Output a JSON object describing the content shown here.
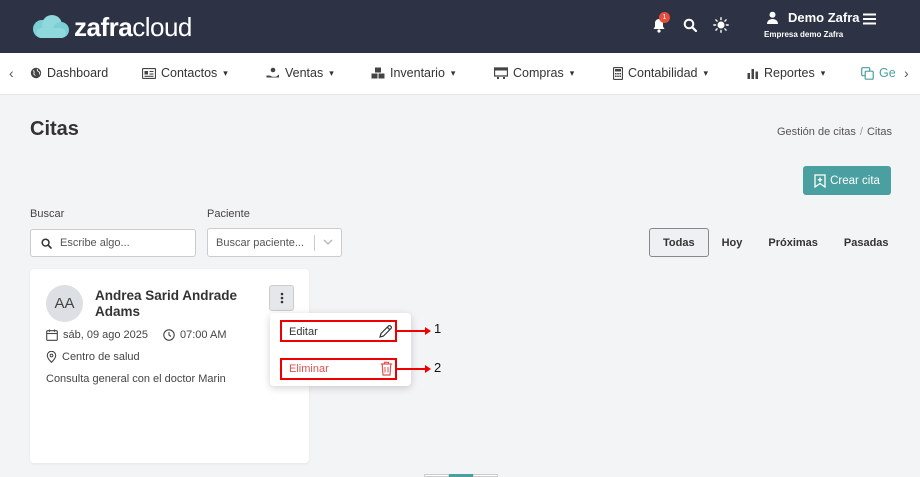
{
  "brand": {
    "logo_bold": "zafra",
    "logo_light": "cloud",
    "accent": "#4a9fa0",
    "header_bg": "#2d3345"
  },
  "header": {
    "notification_count": "1",
    "user_name": "Demo Zafra",
    "company": "Empresa demo Zafra",
    "icons": [
      "bell-icon",
      "search-icon",
      "sun-icon",
      "user-icon",
      "hamburger-icon"
    ]
  },
  "nav": {
    "items": [
      {
        "label": "Dashboard",
        "icon": "globe-icon"
      },
      {
        "label": "Contactos",
        "icon": "contact-card-icon"
      },
      {
        "label": "Ventas",
        "icon": "hand-coin-icon"
      },
      {
        "label": "Inventario",
        "icon": "boxes-icon"
      },
      {
        "label": "Compras",
        "icon": "cart-icon"
      },
      {
        "label": "Contabilidad",
        "icon": "calculator-icon"
      },
      {
        "label": "Reportes",
        "icon": "bar-chart-icon"
      },
      {
        "label": "Ge",
        "icon": "copy-icon"
      }
    ]
  },
  "page": {
    "title": "Citas",
    "breadcrumb": [
      "Gestión de citas",
      "Citas"
    ],
    "create_button": "Crear cita",
    "search_label": "Buscar",
    "search_placeholder": "Escribe algo...",
    "patient_label": "Paciente",
    "patient_placeholder": "Buscar paciente...",
    "filters": [
      "Todas",
      "Hoy",
      "Próximas",
      "Pasadas"
    ],
    "active_filter": "Todas"
  },
  "card": {
    "initials": "AA",
    "name": "Andrea Sarid Andrade Adams",
    "date": "sáb, 09 ago 2025",
    "time": "07:00 AM",
    "location": "Centro de salud",
    "description": "Consulta general con el doctor Marin"
  },
  "menu": {
    "edit_label": "Editar",
    "delete_label": "Eliminar"
  },
  "annotations": {
    "one": "1",
    "two": "2"
  }
}
